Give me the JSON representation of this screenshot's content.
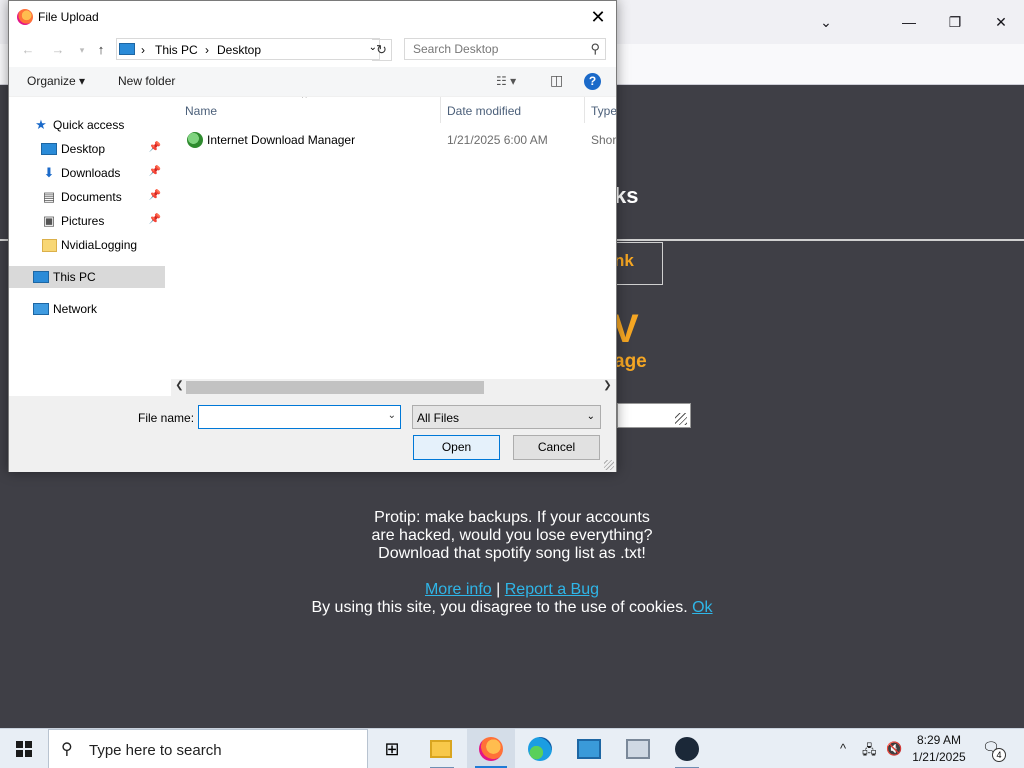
{
  "dialog": {
    "title": "File Upload",
    "close": "✕",
    "address": {
      "crumbs": [
        "This PC",
        "Desktop"
      ]
    },
    "search_placeholder": "Search Desktop",
    "toolbar": {
      "organize": "Organize ▾",
      "new_folder": "New folder",
      "help": "?"
    },
    "nav": [
      {
        "label": "Quick access",
        "icon": "star-icon"
      },
      {
        "label": "Desktop",
        "icon": "desktop-icon",
        "pinned": true
      },
      {
        "label": "Downloads",
        "icon": "downloads-icon",
        "pinned": true
      },
      {
        "label": "Documents",
        "icon": "documents-icon",
        "pinned": true
      },
      {
        "label": "Pictures",
        "icon": "pictures-icon",
        "pinned": true
      },
      {
        "label": "NvidiaLogging",
        "icon": "folder-icon"
      },
      {
        "label": "This PC",
        "icon": "this-pc-icon",
        "selected": true
      },
      {
        "label": "Network",
        "icon": "network-icon"
      }
    ],
    "columns": [
      "Name",
      "Date modified",
      "Type"
    ],
    "files": [
      {
        "name": "Internet Download Manager",
        "date": "1/21/2025 6:00 AM",
        "type": "Short"
      }
    ],
    "file_name_label": "File name:",
    "file_name_value": "",
    "filter": "All Files",
    "open_button": "Open",
    "cancel_button": "Cancel"
  },
  "page": {
    "title_fragment": "ks",
    "link_fragment": "nk",
    "big_fragment": "V",
    "sub_fragment": "age",
    "protip": [
      "Protip: make backups. If your accounts",
      "are hacked, would you lose everything?",
      "Download that spotify song list as .txt!"
    ],
    "more_info": "More info",
    "separator": "|",
    "report_bug": "Report a Bug",
    "cookie_text": "By using this site, you disagree to the use of cookies.",
    "cookie_ok": "Ok"
  },
  "taskbar": {
    "search_placeholder": "Type here to search",
    "time": "8:29 AM",
    "date": "1/21/2025",
    "notifications": "4"
  },
  "colors": {
    "accent": "#f5a623",
    "link": "#2fb6e8",
    "page_bg": "#3f3f46",
    "selection": "#0078d7"
  }
}
